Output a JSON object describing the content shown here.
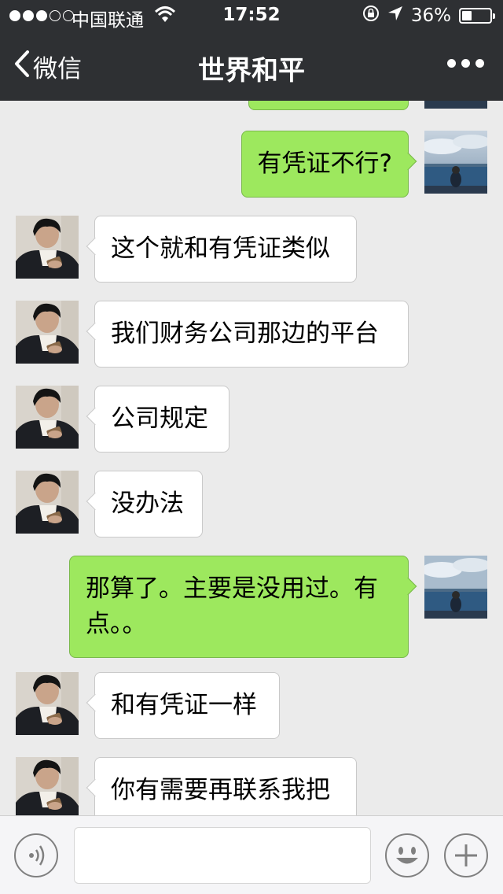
{
  "status_bar": {
    "signal_filled": 3,
    "signal_total": 5,
    "carrier": "中国联通",
    "time": "17:52",
    "battery": "36%",
    "battery_level": 0.36
  },
  "nav": {
    "back_label": "微信",
    "title": "世界和平"
  },
  "messages": [
    {
      "side": "left",
      "avatar": "contact-avatar",
      "text": "这个就和有凭证类似"
    },
    {
      "side": "left",
      "avatar": "contact-avatar",
      "text": "我们财务公司那边的平台"
    },
    {
      "side": "left",
      "avatar": "contact-avatar",
      "text": "公司规定"
    },
    {
      "side": "left",
      "avatar": "contact-avatar",
      "text": "没办法"
    },
    {
      "side": "right",
      "avatar": "self-avatar",
      "text": "那算了。主要是没用过。有点。。"
    },
    {
      "side": "left",
      "avatar": "contact-avatar",
      "text": "和有凭证一样"
    },
    {
      "side": "left",
      "avatar": "contact-avatar",
      "text": "你有需要再联系我把"
    }
  ],
  "pinned_message": {
    "side": "right",
    "avatar": "self-avatar",
    "text": "有凭证不行?"
  },
  "input_bar": {
    "voice_icon": "voice-icon",
    "emoji_icon": "emoji-icon",
    "plus_icon": "plus-icon",
    "text_value": ""
  },
  "colors": {
    "header_bg": "#2e3033",
    "chat_bg": "#ebebeb",
    "sent_bubble": "#9de85e",
    "received_bubble": "#ffffff"
  }
}
